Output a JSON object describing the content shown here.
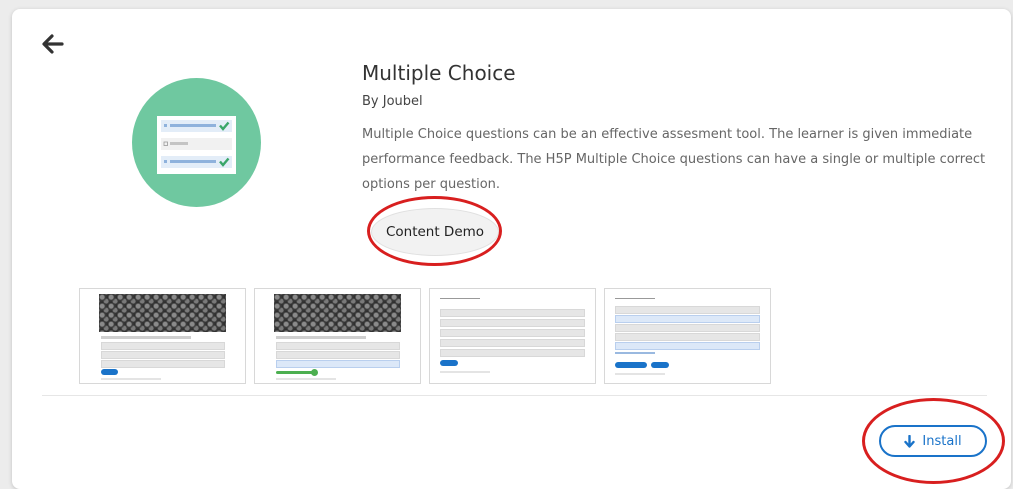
{
  "content_type": {
    "title": "Multiple Choice",
    "author": "By Joubel",
    "description": "Multiple Choice questions can be an effective assesment tool. The learner is given immediate performance feedback. The H5P Multiple Choice questions can have a single or multiple correct options per question."
  },
  "buttons": {
    "back_icon": "arrow-left-icon",
    "demo_label": "Content Demo",
    "install_label": "Install",
    "install_icon": "arrow-down-icon"
  },
  "icon": {
    "name": "multiple-choice-icon",
    "circle_color": "#6fc8a0",
    "check_color": "#3aa66a"
  },
  "screenshots": [
    {
      "name": "screenshot-1"
    },
    {
      "name": "screenshot-2"
    },
    {
      "name": "screenshot-3"
    },
    {
      "name": "screenshot-4"
    }
  ],
  "colors": {
    "accent": "#1a73c9",
    "highlight_ring": "#d81f1f"
  }
}
